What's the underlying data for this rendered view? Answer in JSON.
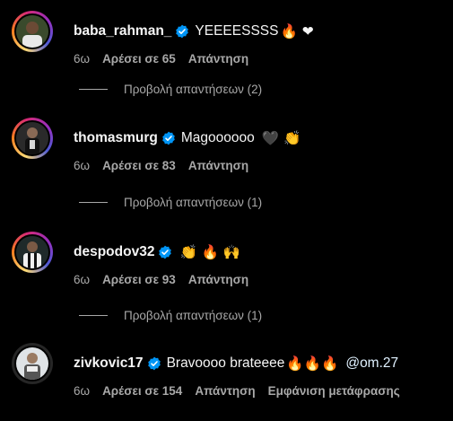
{
  "comments": [
    {
      "username": "baba_rahman_",
      "text": "YEEEESSSS",
      "emojis": "🔥 ❤",
      "time": "6ω",
      "likes": "Αρέσει σε 65",
      "reply": "Απάντηση",
      "view_replies": "Προβολή απαντήσεων (2)"
    },
    {
      "username": "thomasmurg",
      "text": "Magoooooo",
      "emojis": "🖤 👏",
      "time": "6ω",
      "likes": "Αρέσει σε 83",
      "reply": "Απάντηση",
      "view_replies": "Προβολή απαντήσεων (1)"
    },
    {
      "username": "despodov32",
      "text": "",
      "emojis": "👏 🔥 🙌",
      "time": "6ω",
      "likes": "Αρέσει σε 93",
      "reply": "Απάντηση",
      "view_replies": "Προβολή απαντήσεων (1)"
    },
    {
      "username": "zivkovic17",
      "text": "Bravoooo brateeee",
      "emojis": "🔥🔥🔥",
      "mention": "@om.27",
      "time": "6ω",
      "likes": "Αρέσει σε 154",
      "reply": "Απάντηση",
      "translate": "Εμφάνιση μετάφρασης"
    }
  ],
  "colors": {
    "background": "#000000",
    "text": "#f5f5f5",
    "secondary": "#a8a8a8",
    "verified": "#0095f6"
  }
}
